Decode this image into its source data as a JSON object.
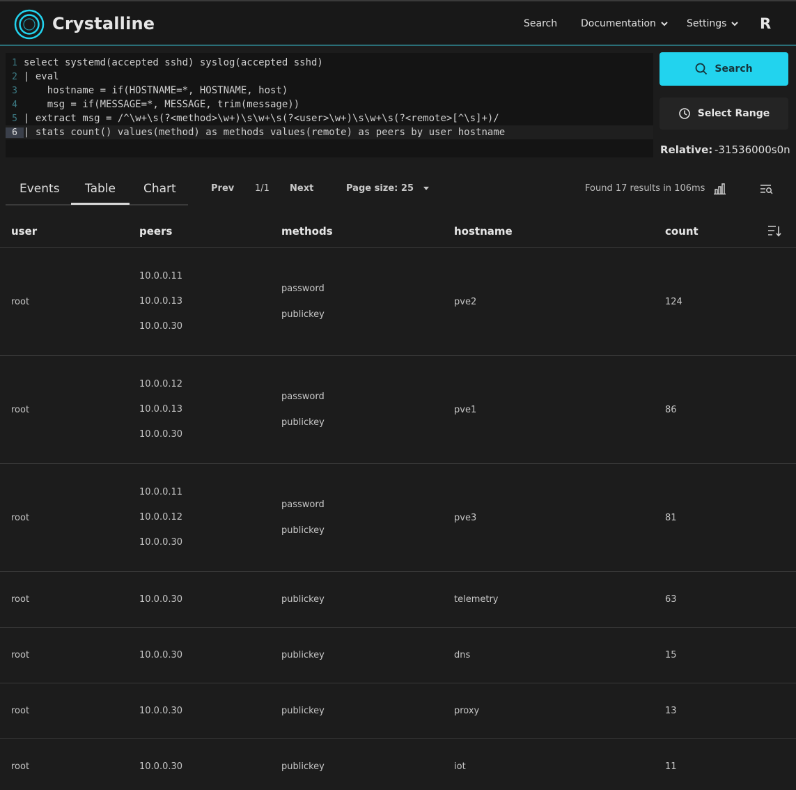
{
  "navbar": {
    "app_name": "Crystalline",
    "search_label": "Search",
    "docs_label": "Documentation",
    "settings_label": "Settings",
    "avatar_initial": "R",
    "accent_color": "#22d3ee"
  },
  "editor": {
    "lines": [
      {
        "num": "1",
        "text": "select systemd(accepted sshd) syslog(accepted sshd)"
      },
      {
        "num": "2",
        "text": "| eval"
      },
      {
        "num": "3",
        "text": "    hostname = if(HOSTNAME=*, HOSTNAME, host)"
      },
      {
        "num": "4",
        "text": "    msg = if(MESSAGE=*, MESSAGE, trim(message))"
      },
      {
        "num": "5",
        "text": "| extract msg = /^\\w+\\s(?<method>\\w+)\\s\\w+\\s(?<user>\\w+)\\s\\w+\\s(?<remote>[^\\s]+)/"
      },
      {
        "num": "6",
        "text": "| stats count() values(method) as methods values(remote) as peers by user hostname"
      }
    ],
    "active_line": "6"
  },
  "controls": {
    "search_button": "Search",
    "range_button": "Select Range",
    "relative_label": "Relative:",
    "relative_value": "-31536000s0n"
  },
  "tabs": [
    "Events",
    "Table",
    "Chart"
  ],
  "active_tab": "Table",
  "pager": {
    "prev": "Prev",
    "info": "1/1",
    "next": "Next",
    "page_size": "Page size: 25",
    "found": "Found 17 results in 106ms"
  },
  "table": {
    "columns": [
      "user",
      "peers",
      "methods",
      "hostname",
      "count"
    ],
    "rows": [
      {
        "user": "root",
        "peers": [
          "10.0.0.11",
          "10.0.0.13",
          "10.0.0.30"
        ],
        "methods": [
          "password",
          "publickey"
        ],
        "hostname": "pve2",
        "count": "124"
      },
      {
        "user": "root",
        "peers": [
          "10.0.0.12",
          "10.0.0.13",
          "10.0.0.30"
        ],
        "methods": [
          "password",
          "publickey"
        ],
        "hostname": "pve1",
        "count": "86"
      },
      {
        "user": "root",
        "peers": [
          "10.0.0.11",
          "10.0.0.12",
          "10.0.0.30"
        ],
        "methods": [
          "password",
          "publickey"
        ],
        "hostname": "pve3",
        "count": "81"
      },
      {
        "user": "root",
        "peers": [
          "10.0.0.30"
        ],
        "methods": [
          "publickey"
        ],
        "hostname": "telemetry",
        "count": "63"
      },
      {
        "user": "root",
        "peers": [
          "10.0.0.30"
        ],
        "methods": [
          "publickey"
        ],
        "hostname": "dns",
        "count": "15"
      },
      {
        "user": "root",
        "peers": [
          "10.0.0.30"
        ],
        "methods": [
          "publickey"
        ],
        "hostname": "proxy",
        "count": "13"
      },
      {
        "user": "root",
        "peers": [
          "10.0.0.30"
        ],
        "methods": [
          "publickey"
        ],
        "hostname": "iot",
        "count": "11"
      }
    ]
  }
}
